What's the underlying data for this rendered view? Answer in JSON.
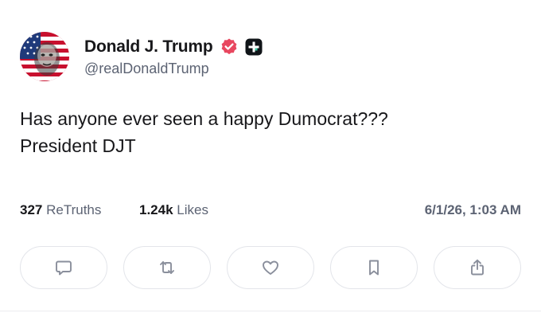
{
  "author": {
    "display_name": "Donald J. Trump",
    "handle": "@realDonaldTrump",
    "avatar_icon": "flag-portrait-avatar",
    "verified_icon": "verified-badge-icon",
    "verified_color": "#e8475f",
    "plus_icon": "plus-badge-icon"
  },
  "post": {
    "lines": [
      "Has anyone ever seen a happy Dumocrat???",
      "President DJT"
    ]
  },
  "stats": {
    "retruths_count": "327",
    "retruths_label": "ReTruths",
    "likes_count": "1.24k",
    "likes_label": "Likes",
    "timestamp": "6/1/26, 1:03 AM"
  },
  "actions": [
    {
      "name": "reply",
      "icon": "reply-icon"
    },
    {
      "name": "retruth",
      "icon": "retruth-icon"
    },
    {
      "name": "like",
      "icon": "heart-icon"
    },
    {
      "name": "bookmark",
      "icon": "bookmark-icon"
    },
    {
      "name": "share",
      "icon": "share-icon"
    }
  ],
  "colors": {
    "text": "#17171a",
    "muted": "#5c6373",
    "border": "#e3e5ea",
    "action_icon": "#8a8f9c"
  }
}
